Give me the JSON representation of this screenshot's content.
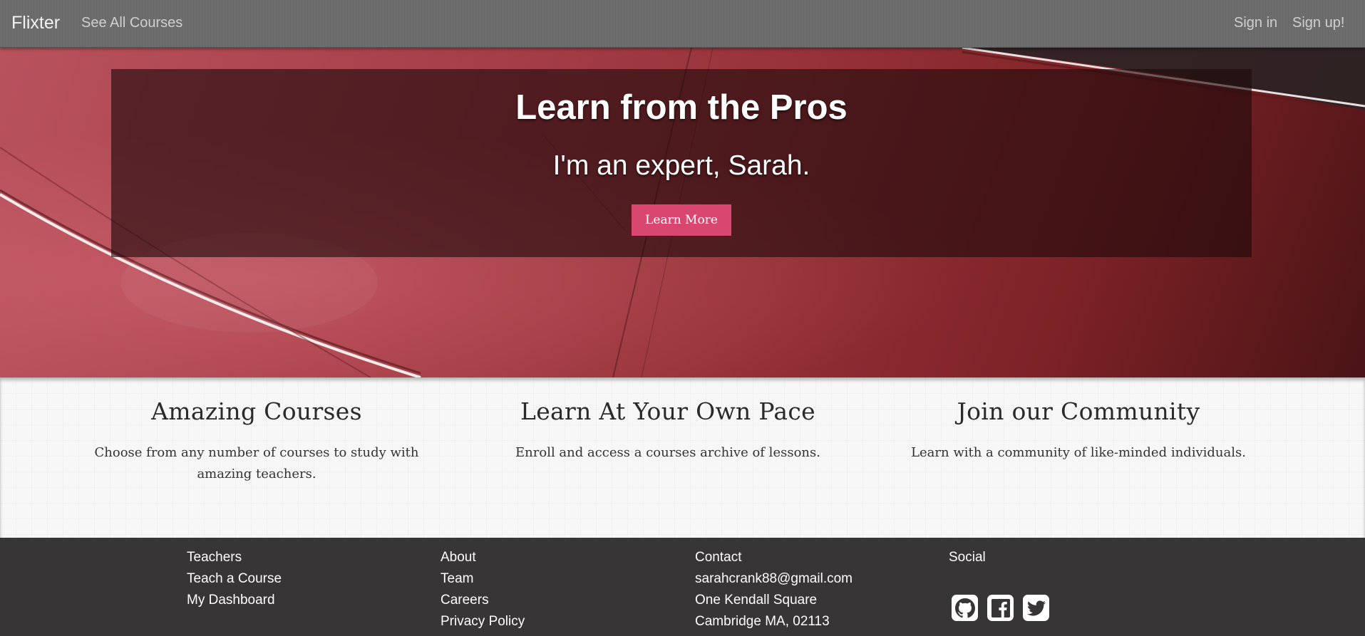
{
  "navbar": {
    "brand": "Flixter",
    "courses_link": "See All Courses",
    "signin_link": "Sign in",
    "signup_link": "Sign up!"
  },
  "hero": {
    "title": "Learn from the Pros",
    "subtitle": "I'm an expert, Sarah.",
    "button": "Learn More"
  },
  "features": [
    {
      "title": "Amazing Courses",
      "text": "Choose from any number of courses to study with amazing teachers."
    },
    {
      "title": "Learn At Your Own Pace",
      "text": "Enroll and access a courses archive of lessons."
    },
    {
      "title": "Join our Community",
      "text": "Learn with a community of like-minded individuals."
    }
  ],
  "footer": {
    "teachers": {
      "heading": "Teachers",
      "links": [
        "Teach a Course",
        "My Dashboard"
      ]
    },
    "about": {
      "heading": "About",
      "links": [
        "Team",
        "Careers",
        "Privacy Policy"
      ]
    },
    "contact": {
      "heading": "Contact",
      "lines": [
        "sarahcrank88@gmail.com",
        "One Kendall Square",
        "Cambridge MA, 02113"
      ]
    },
    "social": {
      "heading": "Social",
      "icons": [
        "github-icon",
        "facebook-icon",
        "twitter-icon"
      ]
    }
  },
  "colors": {
    "accent_button": "#d9466f",
    "navbar": "#6a6a6a",
    "footer": "#373536"
  }
}
